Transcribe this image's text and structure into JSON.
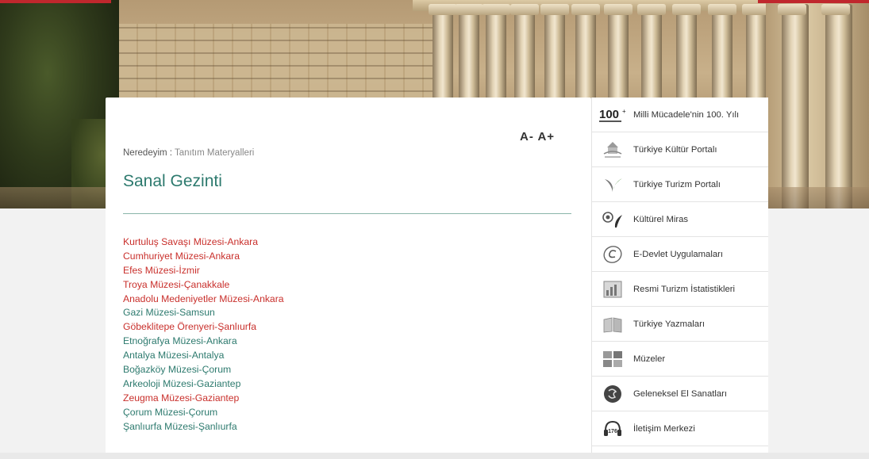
{
  "colors": {
    "accent_teal": "#2d7a6e",
    "link_red": "#c9302c",
    "brand_red": "#c0272d"
  },
  "font_controls": {
    "decrease": "A-",
    "increase": "A+"
  },
  "breadcrumb": {
    "prefix": "Neredeyim :",
    "current": "Tanıtım Materyalleri"
  },
  "page_title": "Sanal Gezinti",
  "museum_links": [
    {
      "label": "Kurtuluş Savaşı Müzesi-Ankara",
      "color": "red"
    },
    {
      "label": "Cumhuriyet Müzesi-Ankara",
      "color": "red"
    },
    {
      "label": "Efes Müzesi-İzmir",
      "color": "red"
    },
    {
      "label": "Troya Müzesi-Çanakkale",
      "color": "red"
    },
    {
      "label": "Anadolu Medeniyetler Müzesi-Ankara",
      "color": "red"
    },
    {
      "label": "Gazi Müzesi-Samsun",
      "color": "teal"
    },
    {
      "label": "Göbeklitepe Örenyeri-Şanlıurfa",
      "color": "red"
    },
    {
      "label": "Etnoğrafya Müzesi-Ankara",
      "color": "teal"
    },
    {
      "label": "Antalya Müzesi-Antalya",
      "color": "teal"
    },
    {
      "label": "Boğazköy Müzesi-Çorum",
      "color": "teal"
    },
    {
      "label": "Arkeoloji Müzesi-Gaziantep",
      "color": "teal"
    },
    {
      "label": "Zeugma Müzesi-Gaziantep",
      "color": "red"
    },
    {
      "label": "Çorum Müzesi-Çorum",
      "color": "teal"
    },
    {
      "label": "Şanlıurfa Müzesi-Şanlıurfa",
      "color": "teal"
    }
  ],
  "sidebar": {
    "items": [
      {
        "label": "Milli Mücadele'nin 100. Yılı",
        "icon": "100th-anniversary-icon",
        "icon_text": "100"
      },
      {
        "label": "Türkiye Kültür Portalı",
        "icon": "culture-portal-icon"
      },
      {
        "label": "Türkiye Turizm Portalı",
        "icon": "tourism-portal-icon"
      },
      {
        "label": "Kültürel Miras",
        "icon": "cultural-heritage-icon"
      },
      {
        "label": "E-Devlet Uygulamaları",
        "icon": "e-government-icon"
      },
      {
        "label": "Resmi Turizm İstatistikleri",
        "icon": "statistics-icon"
      },
      {
        "label": "Türkiye Yazmaları",
        "icon": "manuscripts-icon"
      },
      {
        "label": "Müzeler",
        "icon": "museums-icon"
      },
      {
        "label": "Geleneksel El Sanatları",
        "icon": "handicrafts-icon"
      },
      {
        "label": "İletişim Merkezi",
        "icon": "contact-center-icon",
        "icon_text": "176"
      }
    ]
  }
}
